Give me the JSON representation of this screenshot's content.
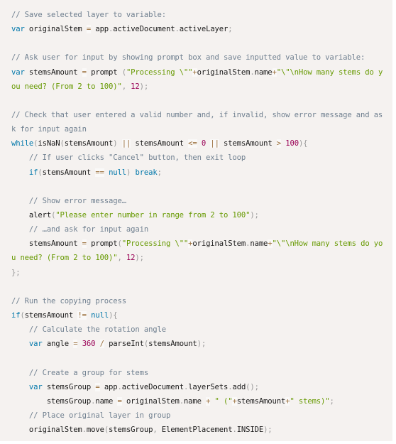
{
  "code_block": {
    "language": "javascript",
    "lines": [
      [
        {
          "t": "comment",
          "v": "// Save selected layer to variable:"
        }
      ],
      [
        {
          "t": "keyword",
          "v": "var"
        },
        {
          "t": "plain",
          "v": " originalStem "
        },
        {
          "t": "operator",
          "v": "="
        },
        {
          "t": "plain",
          "v": " app"
        },
        {
          "t": "punct",
          "v": "."
        },
        {
          "t": "plain",
          "v": "activeDocument"
        },
        {
          "t": "punct",
          "v": "."
        },
        {
          "t": "plain",
          "v": "activeLayer"
        },
        {
          "t": "punct",
          "v": ";"
        }
      ],
      [],
      [
        {
          "t": "comment",
          "v": "// Ask user for input by showing prompt box and save inputted value to variable:"
        }
      ],
      [
        {
          "t": "keyword",
          "v": "var"
        },
        {
          "t": "plain",
          "v": " stemsAmount "
        },
        {
          "t": "operator",
          "v": "="
        },
        {
          "t": "plain",
          "v": " prompt "
        },
        {
          "t": "punct",
          "v": "("
        },
        {
          "t": "string",
          "v": "\"Processing \\\"\""
        },
        {
          "t": "operator",
          "v": "+"
        },
        {
          "t": "plain",
          "v": "originalStem"
        },
        {
          "t": "punct",
          "v": "."
        },
        {
          "t": "plain",
          "v": "name"
        },
        {
          "t": "operator",
          "v": "+"
        },
        {
          "t": "string",
          "v": "\"\\\"\\nHow many stems do y"
        }
      ],
      [
        {
          "t": "string",
          "v": "ou need? (From 2 to 100)\""
        },
        {
          "t": "punct",
          "v": ","
        },
        {
          "t": "plain",
          "v": " "
        },
        {
          "t": "number",
          "v": "12"
        },
        {
          "t": "punct",
          "v": ");"
        }
      ],
      [],
      [
        {
          "t": "comment",
          "v": "// Check that user entered a valid number and, if invalid, show error message and as"
        }
      ],
      [
        {
          "t": "comment",
          "v": "k for input again"
        }
      ],
      [
        {
          "t": "keyword",
          "v": "while"
        },
        {
          "t": "punct",
          "v": "("
        },
        {
          "t": "plain",
          "v": "isNaN"
        },
        {
          "t": "punct",
          "v": "("
        },
        {
          "t": "plain",
          "v": "stemsAmount"
        },
        {
          "t": "punct",
          "v": ")"
        },
        {
          "t": "plain",
          "v": " "
        },
        {
          "t": "operator",
          "v": "||"
        },
        {
          "t": "plain",
          "v": " stemsAmount "
        },
        {
          "t": "operator",
          "v": "<="
        },
        {
          "t": "plain",
          "v": " "
        },
        {
          "t": "number",
          "v": "0"
        },
        {
          "t": "plain",
          "v": " "
        },
        {
          "t": "operator",
          "v": "||"
        },
        {
          "t": "plain",
          "v": " stemsAmount "
        },
        {
          "t": "operator",
          "v": ">"
        },
        {
          "t": "plain",
          "v": " "
        },
        {
          "t": "number",
          "v": "100"
        },
        {
          "t": "punct",
          "v": "){"
        }
      ],
      [
        {
          "t": "plain",
          "v": "    "
        },
        {
          "t": "comment",
          "v": "// If user clicks \"Cancel\" button, then exit loop"
        }
      ],
      [
        {
          "t": "plain",
          "v": "    "
        },
        {
          "t": "keyword",
          "v": "if"
        },
        {
          "t": "punct",
          "v": "("
        },
        {
          "t": "plain",
          "v": "stemsAmount "
        },
        {
          "t": "operator",
          "v": "=="
        },
        {
          "t": "plain",
          "v": " "
        },
        {
          "t": "keyword",
          "v": "null"
        },
        {
          "t": "punct",
          "v": ")"
        },
        {
          "t": "plain",
          "v": " "
        },
        {
          "t": "keyword",
          "v": "break"
        },
        {
          "t": "punct",
          "v": ";"
        }
      ],
      [],
      [
        {
          "t": "plain",
          "v": "    "
        },
        {
          "t": "comment",
          "v": "// Show error message…"
        }
      ],
      [
        {
          "t": "plain",
          "v": "    alert"
        },
        {
          "t": "punct",
          "v": "("
        },
        {
          "t": "string",
          "v": "\"Please enter number in range from 2 to 100\""
        },
        {
          "t": "punct",
          "v": ");"
        }
      ],
      [
        {
          "t": "plain",
          "v": "    "
        },
        {
          "t": "comment",
          "v": "// …and ask for input again"
        }
      ],
      [
        {
          "t": "plain",
          "v": "    stemsAmount "
        },
        {
          "t": "operator",
          "v": "="
        },
        {
          "t": "plain",
          "v": " prompt"
        },
        {
          "t": "punct",
          "v": "("
        },
        {
          "t": "string",
          "v": "\"Processing \\\"\""
        },
        {
          "t": "operator",
          "v": "+"
        },
        {
          "t": "plain",
          "v": "originalStem"
        },
        {
          "t": "punct",
          "v": "."
        },
        {
          "t": "plain",
          "v": "name"
        },
        {
          "t": "operator",
          "v": "+"
        },
        {
          "t": "string",
          "v": "\"\\\"\\nHow many stems do yo"
        }
      ],
      [
        {
          "t": "string",
          "v": "u need? (From 2 to 100)\""
        },
        {
          "t": "punct",
          "v": ","
        },
        {
          "t": "plain",
          "v": " "
        },
        {
          "t": "number",
          "v": "12"
        },
        {
          "t": "punct",
          "v": ");"
        }
      ],
      [
        {
          "t": "punct",
          "v": "};"
        }
      ],
      [],
      [
        {
          "t": "comment",
          "v": "// Run the copying process"
        }
      ],
      [
        {
          "t": "keyword",
          "v": "if"
        },
        {
          "t": "punct",
          "v": "("
        },
        {
          "t": "plain",
          "v": "stemsAmount "
        },
        {
          "t": "operator",
          "v": "!="
        },
        {
          "t": "plain",
          "v": " "
        },
        {
          "t": "keyword",
          "v": "null"
        },
        {
          "t": "punct",
          "v": "){"
        }
      ],
      [
        {
          "t": "plain",
          "v": "    "
        },
        {
          "t": "comment",
          "v": "// Calculate the rotation angle"
        }
      ],
      [
        {
          "t": "plain",
          "v": "    "
        },
        {
          "t": "keyword",
          "v": "var"
        },
        {
          "t": "plain",
          "v": " angle "
        },
        {
          "t": "operator",
          "v": "="
        },
        {
          "t": "plain",
          "v": " "
        },
        {
          "t": "number",
          "v": "360"
        },
        {
          "t": "plain",
          "v": " "
        },
        {
          "t": "operator",
          "v": "/"
        },
        {
          "t": "plain",
          "v": " parseInt"
        },
        {
          "t": "punct",
          "v": "("
        },
        {
          "t": "plain",
          "v": "stemsAmount"
        },
        {
          "t": "punct",
          "v": ");"
        }
      ],
      [],
      [
        {
          "t": "plain",
          "v": "    "
        },
        {
          "t": "comment",
          "v": "// Create a group for stems"
        }
      ],
      [
        {
          "t": "plain",
          "v": "    "
        },
        {
          "t": "keyword",
          "v": "var"
        },
        {
          "t": "plain",
          "v": " stemsGroup "
        },
        {
          "t": "operator",
          "v": "="
        },
        {
          "t": "plain",
          "v": " app"
        },
        {
          "t": "punct",
          "v": "."
        },
        {
          "t": "plain",
          "v": "activeDocument"
        },
        {
          "t": "punct",
          "v": "."
        },
        {
          "t": "plain",
          "v": "layerSets"
        },
        {
          "t": "punct",
          "v": "."
        },
        {
          "t": "plain",
          "v": "add"
        },
        {
          "t": "punct",
          "v": "();"
        }
      ],
      [
        {
          "t": "plain",
          "v": "        stemsGroup"
        },
        {
          "t": "punct",
          "v": "."
        },
        {
          "t": "plain",
          "v": "name "
        },
        {
          "t": "operator",
          "v": "="
        },
        {
          "t": "plain",
          "v": " originalStem"
        },
        {
          "t": "punct",
          "v": "."
        },
        {
          "t": "plain",
          "v": "name "
        },
        {
          "t": "operator",
          "v": "+"
        },
        {
          "t": "plain",
          "v": " "
        },
        {
          "t": "string",
          "v": "\" (\""
        },
        {
          "t": "operator",
          "v": "+"
        },
        {
          "t": "plain",
          "v": "stemsAmount"
        },
        {
          "t": "operator",
          "v": "+"
        },
        {
          "t": "string",
          "v": "\" stems)\""
        },
        {
          "t": "punct",
          "v": ";"
        }
      ],
      [
        {
          "t": "plain",
          "v": "    "
        },
        {
          "t": "comment",
          "v": "// Place original layer in group"
        }
      ],
      [
        {
          "t": "plain",
          "v": "    originalStem"
        },
        {
          "t": "punct",
          "v": "."
        },
        {
          "t": "plain",
          "v": "move"
        },
        {
          "t": "punct",
          "v": "("
        },
        {
          "t": "plain",
          "v": "stemsGroup"
        },
        {
          "t": "punct",
          "v": ","
        },
        {
          "t": "plain",
          "v": " ElementPlacement"
        },
        {
          "t": "punct",
          "v": "."
        },
        {
          "t": "plain",
          "v": "INSIDE"
        },
        {
          "t": "punct",
          "v": ");"
        }
      ]
    ]
  },
  "colors": {
    "background": "#f5f2f0",
    "comment": "#708090",
    "keyword": "#0077aa",
    "string": "#669900",
    "number": "#990055",
    "operator": "#9a6e3a",
    "punctuation": "#999999",
    "plain": "#1a1a1a"
  }
}
